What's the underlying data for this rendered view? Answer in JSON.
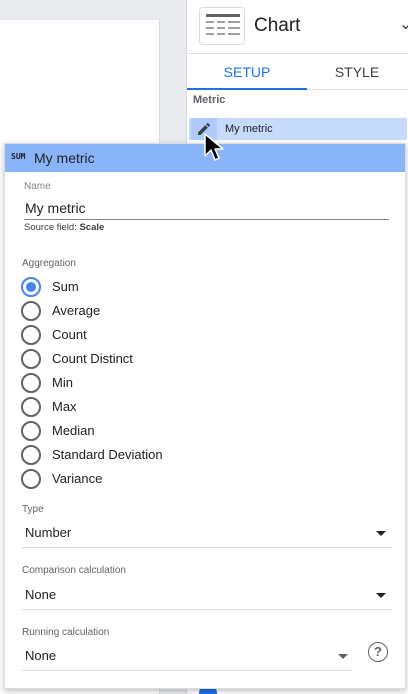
{
  "panel": {
    "chart_title": "Chart",
    "chart_icon": "table-chart-icon",
    "tabs": [
      {
        "label": "SETUP",
        "active": true
      },
      {
        "label": "STYLE",
        "active": false
      }
    ],
    "section_label": "Metric",
    "metric_chip_label": "My metric",
    "accent_color": "#1a73e8"
  },
  "editor": {
    "badge": "SUM",
    "title": "My metric",
    "name_label": "Name",
    "name_value": "My metric",
    "source_field_prefix": "Source field: ",
    "source_field_value": "Scale",
    "aggregation_label": "Aggregation",
    "aggregation_options": [
      {
        "label": "Sum",
        "selected": true
      },
      {
        "label": "Average",
        "selected": false
      },
      {
        "label": "Count",
        "selected": false
      },
      {
        "label": "Count Distinct",
        "selected": false
      },
      {
        "label": "Min",
        "selected": false
      },
      {
        "label": "Max",
        "selected": false
      },
      {
        "label": "Median",
        "selected": false
      },
      {
        "label": "Standard Deviation",
        "selected": false
      },
      {
        "label": "Variance",
        "selected": false
      }
    ],
    "type": {
      "label": "Type",
      "value": "Number"
    },
    "comparison": {
      "label": "Comparison calculation",
      "value": "None"
    },
    "running": {
      "label": "Running calculation",
      "value": "None"
    },
    "header_color": "#8ab4f8",
    "radio_color": "#4285f4"
  }
}
